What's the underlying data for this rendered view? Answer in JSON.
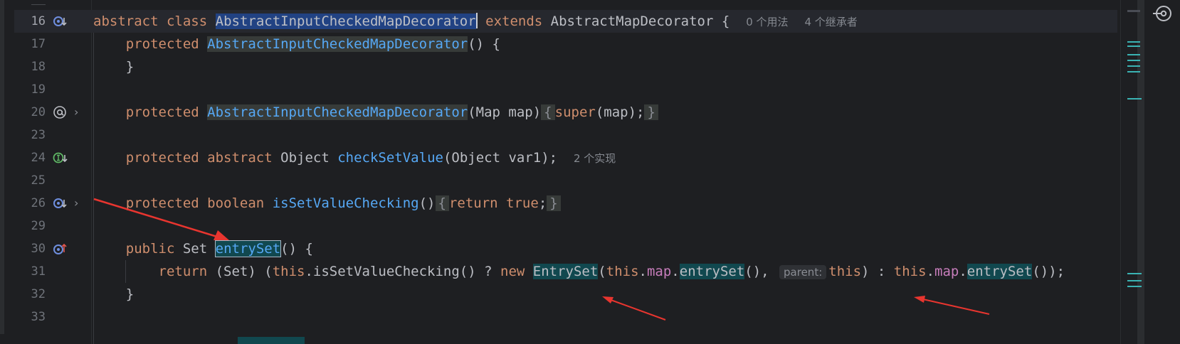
{
  "lines": [
    {
      "num": "16",
      "current": true,
      "icon": "override-implemented-icon",
      "chevron": false
    },
    {
      "num": "17"
    },
    {
      "num": "18"
    },
    {
      "num": "19"
    },
    {
      "num": "20",
      "icon": "annotation-icon",
      "chevron": true
    },
    {
      "num": "23"
    },
    {
      "num": "24",
      "icon": "implemented-interface-icon"
    },
    {
      "num": "25"
    },
    {
      "num": "26",
      "icon": "override-implemented-icon",
      "chevron": true
    },
    {
      "num": "29"
    },
    {
      "num": "30",
      "icon": "overrides-method-icon"
    },
    {
      "num": "31"
    },
    {
      "num": "32"
    },
    {
      "num": "33"
    }
  ],
  "code": {
    "l16": {
      "kw_abstract": "abstract",
      "kw_class": "class",
      "class_name": "AbstractInputCheckedMapDecorator",
      "kw_extends": "extends",
      "super_name": "AbstractMapDecorator",
      "brace": "{",
      "hint_usages": "0 个用法",
      "hint_inheritors": "4 个继承者"
    },
    "l17": {
      "kw": "protected",
      "name": "AbstractInputCheckedMapDecorator",
      "rest": "() {"
    },
    "l18": {
      "text": "}"
    },
    "l20": {
      "kw": "protected",
      "name": "AbstractInputCheckedMapDecorator",
      "params": "(Map map)",
      "fold_open": "{",
      "kw_super": "super",
      "args": "(map);",
      "fold_close": "}"
    },
    "l24": {
      "kw1": "protected",
      "kw2": "abstract",
      "type": "Object",
      "name": "checkSetValue",
      "params": "(Object var1);",
      "hint": "2 个实现"
    },
    "l26": {
      "kw1": "protected",
      "kw2": "boolean",
      "name": "isSetValueChecking",
      "paren": "()",
      "fold_open": "{",
      "kw_return": "return",
      "kw_true": "true",
      "semi": ";",
      "fold_close": "}"
    },
    "l30": {
      "kw": "public",
      "type": "Set",
      "name": "entrySet",
      "rest": "() {"
    },
    "l31": {
      "kw_return": "return",
      "cast": "(Set) (",
      "kw_this1": "this",
      "call1": ".isSetValueChecking() ? ",
      "kw_new": "new",
      "cls": "EntrySet",
      "open": "(",
      "kw_this2": "this",
      "dot1": ".",
      "fld1": "map",
      "dot2": ".",
      "call2": "entrySet",
      "after2": "(), ",
      "inlay": "parent:",
      "kw_this3": "this",
      "mid": ") : ",
      "kw_this4": "this",
      "dot3": ".",
      "fld2": "map",
      "dot4": ".",
      "call3": "entrySet",
      "end": "());"
    },
    "l32": {
      "text": "}"
    }
  },
  "colors": {
    "background": "#1e1f22",
    "keyword": "#cf8e6d",
    "method": "#56a8f5",
    "field": "#c77dbb",
    "text": "#bcbec4",
    "selection": "#214283",
    "usage_highlight": "#11484f",
    "annotation_arrow": "#e8352f"
  }
}
